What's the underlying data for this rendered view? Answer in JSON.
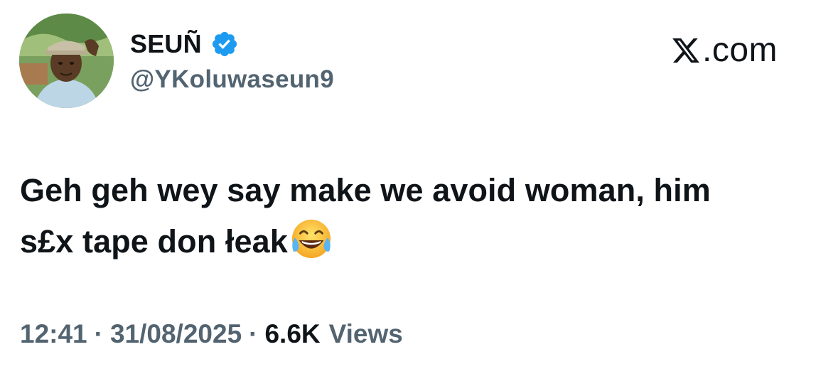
{
  "author": {
    "name": "SEUÑ",
    "handle": "@YKoluwaseun9",
    "verified": true,
    "verified_color": "#1d9bf0"
  },
  "brand": {
    "text": ".com",
    "icon": "x-logo-icon"
  },
  "tweet": {
    "line1": "Geh geh wey say make we avoid woman, him",
    "line2": "s£x tape don łeak",
    "emoji": "face-with-tears-of-joy-icon"
  },
  "meta": {
    "time": "12:41",
    "separator": "·",
    "date": "31/08/2025",
    "views_count": "6.6K",
    "views_label": "Views"
  },
  "colors": {
    "primary_text": "#0f1419",
    "secondary_text": "#536471",
    "background": "#ffffff"
  }
}
